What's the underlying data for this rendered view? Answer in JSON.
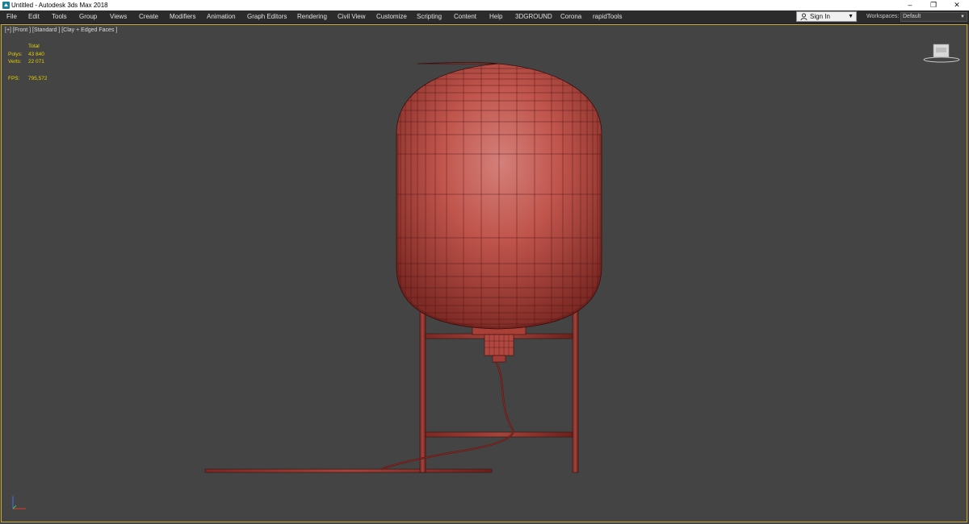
{
  "titlebar": {
    "title": "Untitled - Autodesk 3ds Max 2018",
    "minimize_icon": "minimize-icon",
    "restore_icon": "restore-icon",
    "close_icon": "close-icon"
  },
  "menu": {
    "items": [
      {
        "label": "File"
      },
      {
        "label": "Edit"
      },
      {
        "label": "Tools"
      },
      {
        "label": "Group"
      },
      {
        "label": "Views"
      },
      {
        "label": "Create"
      },
      {
        "label": "Modifiers"
      },
      {
        "label": "Animation"
      },
      {
        "label": "Graph Editors"
      },
      {
        "label": "Rendering"
      },
      {
        "label": "Civil View"
      },
      {
        "label": "Customize"
      },
      {
        "label": "Scripting"
      },
      {
        "label": "Content"
      },
      {
        "label": "Help"
      },
      {
        "label": "3DGROUND"
      },
      {
        "label": "Corona"
      },
      {
        "label": "rapidTools"
      }
    ],
    "sign_in": "Sign In",
    "workspaces_label": "Workspaces:",
    "workspace_value": "Default"
  },
  "viewport": {
    "label": "[+] [Front ] [Standard ] [Clay + Edged Faces ]",
    "stats": {
      "header": "Total",
      "polys_label": "Polys:",
      "polys_value": "43 840",
      "verts_label": "Verts:",
      "verts_value": "22 071",
      "fps_label": "FPS:",
      "fps_value": "795,572"
    }
  },
  "colors": {
    "viewport_bg": "#444444",
    "model_fill": "#b84a42",
    "wire": "#4a1210",
    "stats_text": "#e5d100",
    "active_border": "#c8a93a"
  }
}
